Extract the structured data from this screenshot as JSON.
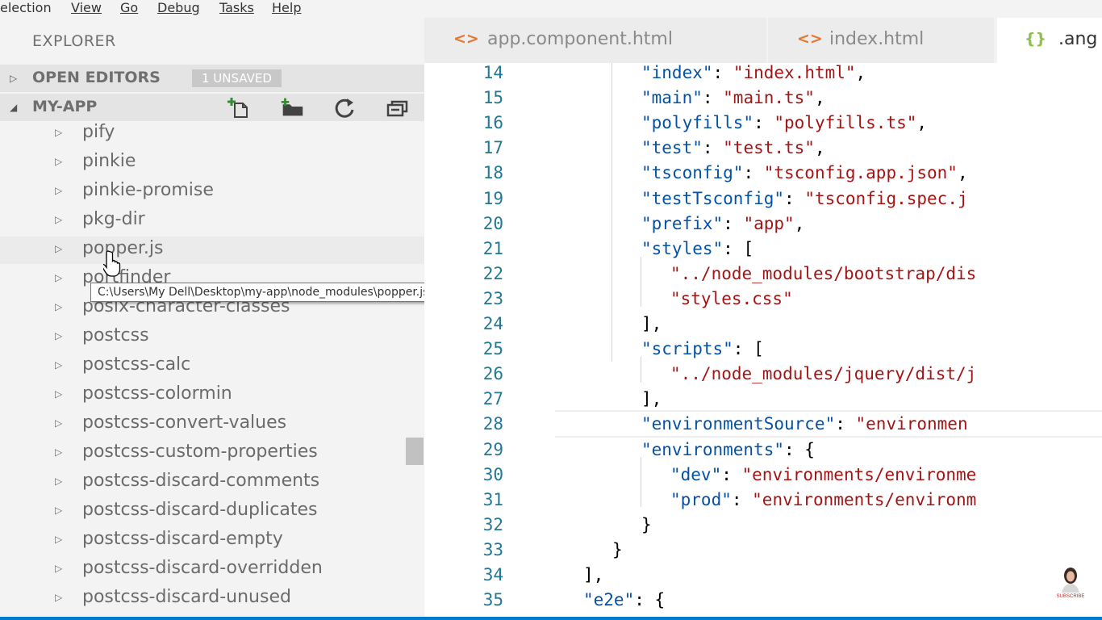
{
  "menu": [
    {
      "label": "election"
    },
    {
      "label": "View"
    },
    {
      "label": "Go"
    },
    {
      "label": "Debug"
    },
    {
      "label": "Tasks"
    },
    {
      "label": "Help"
    }
  ],
  "explorer": {
    "title": "EXPLORER",
    "open_editors": {
      "label": "OPEN EDITORS",
      "badge": "1 UNSAVED"
    },
    "folder": {
      "label": "MY-APP",
      "actions": [
        "new-file-icon",
        "new-folder-icon",
        "refresh-icon",
        "collapse-all-icon"
      ]
    },
    "items": [
      "pify",
      "pinkie",
      "pinkie-promise",
      "pkg-dir",
      "popper.js",
      "portfinder",
      "posix-character-classes",
      "postcss",
      "postcss-calc",
      "postcss-colormin",
      "postcss-convert-values",
      "postcss-custom-properties",
      "postcss-discard-comments",
      "postcss-discard-duplicates",
      "postcss-discard-empty",
      "postcss-discard-overridden",
      "postcss-discard-unused"
    ],
    "hovered_item": "popper.js",
    "tooltip": "C:\\Users\\My Dell\\Desktop\\my-app\\node_modules\\popper.js"
  },
  "tabs": [
    {
      "icon": "<>",
      "label": "app.component.html",
      "icon_color": "#e37933"
    },
    {
      "icon": "<>",
      "label": "index.html",
      "icon_color": "#e37933"
    },
    {
      "icon": "{}",
      "label": ".ang",
      "icon_color": "#8dc149",
      "active": true
    }
  ],
  "editor": {
    "line_numbers": [
      "14",
      "15",
      "16",
      "17",
      "18",
      "19",
      "20",
      "21",
      "22",
      "23",
      "24",
      "25",
      "26",
      "27",
      "28",
      "29",
      "30",
      "31",
      "32",
      "33",
      "34",
      "35"
    ],
    "lines": [
      [
        {
          "t": "k",
          "v": "\"index\""
        },
        {
          "t": "p",
          "v": ": "
        },
        {
          "t": "s",
          "v": "\"index.html\""
        },
        {
          "t": "p",
          "v": ","
        }
      ],
      [
        {
          "t": "k",
          "v": "\"main\""
        },
        {
          "t": "p",
          "v": ": "
        },
        {
          "t": "s",
          "v": "\"main.ts\""
        },
        {
          "t": "p",
          "v": ","
        }
      ],
      [
        {
          "t": "k",
          "v": "\"polyfills\""
        },
        {
          "t": "p",
          "v": ": "
        },
        {
          "t": "s",
          "v": "\"polyfills.ts\""
        },
        {
          "t": "p",
          "v": ","
        }
      ],
      [
        {
          "t": "k",
          "v": "\"test\""
        },
        {
          "t": "p",
          "v": ": "
        },
        {
          "t": "s",
          "v": "\"test.ts\""
        },
        {
          "t": "p",
          "v": ","
        }
      ],
      [
        {
          "t": "k",
          "v": "\"tsconfig\""
        },
        {
          "t": "p",
          "v": ": "
        },
        {
          "t": "s",
          "v": "\"tsconfig.app.json\""
        },
        {
          "t": "p",
          "v": ","
        }
      ],
      [
        {
          "t": "k",
          "v": "\"testTsconfig\""
        },
        {
          "t": "p",
          "v": ": "
        },
        {
          "t": "s",
          "v": "\"tsconfig.spec.j"
        }
      ],
      [
        {
          "t": "k",
          "v": "\"prefix\""
        },
        {
          "t": "p",
          "v": ": "
        },
        {
          "t": "s",
          "v": "\"app\""
        },
        {
          "t": "p",
          "v": ","
        }
      ],
      [
        {
          "t": "k",
          "v": "\"styles\""
        },
        {
          "t": "p",
          "v": ": ["
        }
      ],
      [
        {
          "t": "s",
          "v": "\"../node_modules/bootstrap/dis"
        }
      ],
      [
        {
          "t": "s",
          "v": "\"styles.css\""
        }
      ],
      [
        {
          "t": "p",
          "v": "],"
        }
      ],
      [
        {
          "t": "k",
          "v": "\"scripts\""
        },
        {
          "t": "p",
          "v": ": ["
        }
      ],
      [
        {
          "t": "s",
          "v": "\"../node_modules/jquery/dist/j"
        }
      ],
      [
        {
          "t": "p",
          "v": "],"
        }
      ],
      [
        {
          "t": "k",
          "v": "\"environmentSource\""
        },
        {
          "t": "p",
          "v": ": "
        },
        {
          "t": "s",
          "v": "\"environmen"
        }
      ],
      [
        {
          "t": "k",
          "v": "\"environments\""
        },
        {
          "t": "p",
          "v": ": {"
        }
      ],
      [
        {
          "t": "k",
          "v": "\"dev\""
        },
        {
          "t": "p",
          "v": ": "
        },
        {
          "t": "s",
          "v": "\"environments/environme"
        }
      ],
      [
        {
          "t": "k",
          "v": "\"prod\""
        },
        {
          "t": "p",
          "v": ": "
        },
        {
          "t": "s",
          "v": "\"environments/environm"
        }
      ],
      [
        {
          "t": "p",
          "v": "}"
        }
      ],
      [
        {
          "t": "p",
          "v": "}"
        }
      ],
      [
        {
          "t": "p",
          "v": "],"
        }
      ],
      [
        {
          "t": "k",
          "v": "\"e2e\""
        },
        {
          "t": "p",
          "v": ": {"
        }
      ]
    ]
  },
  "colors": {
    "keyword": "#0451a5",
    "string": "#a31515",
    "line_number": "#237893",
    "status_bar": "#007acc"
  },
  "watermark": {
    "text": "SUBSCRIBE"
  }
}
